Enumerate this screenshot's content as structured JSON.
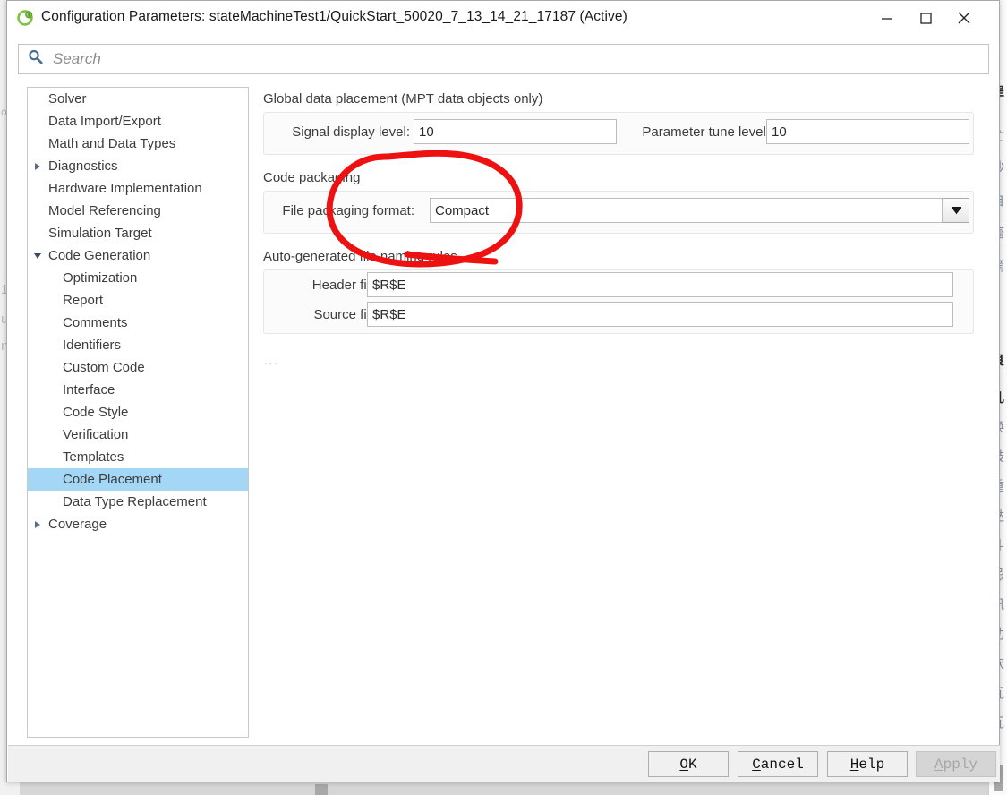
{
  "window": {
    "title": "Configuration Parameters: stateMachineTest1/QuickStart_50020_7_13_14_21_17187 (Active)",
    "icon": "simulink-icon",
    "controls": {
      "minimize": "minimize-icon",
      "maximize": "maximize-icon",
      "close": "close-icon"
    }
  },
  "search": {
    "placeholder": "Search",
    "value": "",
    "icon": "search-icon"
  },
  "tree": {
    "items": [
      {
        "label": "Solver",
        "level": 0,
        "twisty": "none",
        "selected": false
      },
      {
        "label": "Data Import/Export",
        "level": 0,
        "twisty": "none",
        "selected": false
      },
      {
        "label": "Math and Data Types",
        "level": 0,
        "twisty": "none",
        "selected": false
      },
      {
        "label": "Diagnostics",
        "level": 0,
        "twisty": "collapsed",
        "selected": false
      },
      {
        "label": "Hardware Implementation",
        "level": 0,
        "twisty": "none",
        "selected": false
      },
      {
        "label": "Model Referencing",
        "level": 0,
        "twisty": "none",
        "selected": false
      },
      {
        "label": "Simulation Target",
        "level": 0,
        "twisty": "none",
        "selected": false
      },
      {
        "label": "Code Generation",
        "level": 0,
        "twisty": "expanded",
        "selected": false
      },
      {
        "label": "Optimization",
        "level": 1,
        "twisty": "none",
        "selected": false
      },
      {
        "label": "Report",
        "level": 1,
        "twisty": "none",
        "selected": false
      },
      {
        "label": "Comments",
        "level": 1,
        "twisty": "none",
        "selected": false
      },
      {
        "label": "Identifiers",
        "level": 1,
        "twisty": "none",
        "selected": false
      },
      {
        "label": "Custom Code",
        "level": 1,
        "twisty": "none",
        "selected": false
      },
      {
        "label": "Interface",
        "level": 1,
        "twisty": "none",
        "selected": false
      },
      {
        "label": "Code Style",
        "level": 1,
        "twisty": "none",
        "selected": false
      },
      {
        "label": "Verification",
        "level": 1,
        "twisty": "none",
        "selected": false
      },
      {
        "label": "Templates",
        "level": 1,
        "twisty": "none",
        "selected": false
      },
      {
        "label": "Code Placement",
        "level": 1,
        "twisty": "none",
        "selected": true
      },
      {
        "label": "Data Type Replacement",
        "level": 1,
        "twisty": "none",
        "selected": false
      },
      {
        "label": "Coverage",
        "level": 0,
        "twisty": "collapsed",
        "selected": false
      }
    ],
    "selection_color": "#a3d7f5"
  },
  "main": {
    "groups": [
      {
        "title": "Global data placement (MPT data objects only)"
      },
      {
        "title": "Code packaging"
      },
      {
        "title": "Auto-generated file naming rules"
      }
    ],
    "signal_display_level": {
      "label": "Signal display level:",
      "value": "10"
    },
    "parameter_tune_level": {
      "label": "Parameter tune level:",
      "value": "10"
    },
    "file_packaging_format": {
      "label": "File packaging format:",
      "value": "Compact",
      "arrow": "chevron-down-icon"
    },
    "header_files": {
      "label": "Header files:",
      "value": "$R$E"
    },
    "source_files": {
      "label": "Source files:",
      "value": "$R$E"
    },
    "ellipsis": "..."
  },
  "footer": {
    "ok": {
      "pre": "",
      "mnemonic": "O",
      "post": "K",
      "disabled": false
    },
    "cancel": {
      "pre": "",
      "mnemonic": "C",
      "post": "ancel",
      "disabled": false
    },
    "help": {
      "pre": "",
      "mnemonic": "H",
      "post": "elp",
      "disabled": false
    },
    "apply": {
      "pre": "",
      "mnemonic": "A",
      "post": "pply",
      "disabled": true
    }
  },
  "annotation": {
    "color": "#ee1111",
    "shape": "hand-drawn-ellipse",
    "target": "File packaging format: Compact"
  },
  "background": {
    "left_fragments": [
      "od",
      "1",
      "u",
      "n"
    ],
    "right_fragments": [
      "罪",
      "忙",
      "钞",
      "自",
      "搐",
      "摘",
      "良",
      "几",
      "换",
      "鼓",
      "重",
      "哒",
      "斗",
      "忌",
      "訊",
      "动",
      "软",
      "瓦",
      "瓦",
      "瓦",
      "至",
      "替"
    ]
  }
}
